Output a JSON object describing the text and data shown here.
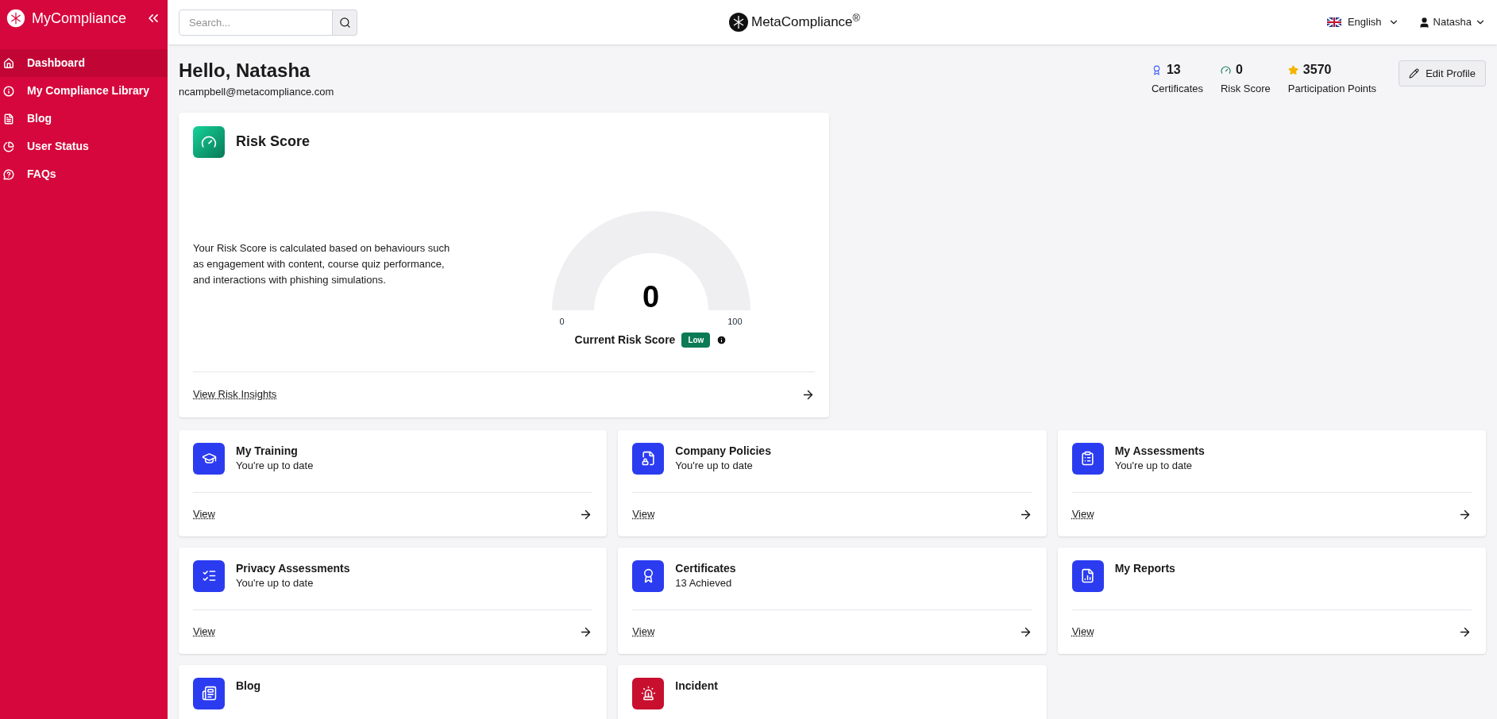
{
  "sidebar": {
    "brand": "MyCompliance",
    "items": [
      {
        "label": "Dashboard",
        "selected": true
      },
      {
        "label": "My Compliance Library",
        "selected": false
      },
      {
        "label": "Blog",
        "selected": false
      },
      {
        "label": "User Status",
        "selected": false
      },
      {
        "label": "FAQs",
        "selected": false
      }
    ]
  },
  "header": {
    "search": {
      "placeholder": "Search..."
    },
    "logo": "MetaCompliance$^{®}$",
    "language": "English",
    "user": "Natasha"
  },
  "greeting": {
    "title": "Hello, Natasha",
    "email": "ncampbell@metacompliance.com"
  },
  "stats": [
    {
      "value": "13",
      "label": "Certificates"
    },
    {
      "value": "0",
      "label": "Risk Score"
    },
    {
      "value": "3570",
      "label": "Participation Points"
    }
  ],
  "edit_profile": "Edit Profile",
  "risk_card": {
    "title": "Risk Score",
    "description": "Your Risk Score is calculated based on behaviours such as engagement with content, course quiz performance, and interactions with phishing simulations.",
    "gauge": {
      "value": "0",
      "min": "0",
      "max": "100"
    },
    "caption": "Current Risk Score",
    "badge": "Low",
    "link": "View Risk Insights"
  },
  "cards": [
    {
      "color": "#2b3cf0",
      "title": "My Training",
      "subtitle": "You're up to date",
      "link": "View"
    },
    {
      "color": "#2b3cf0",
      "title": "Company Policies",
      "subtitle": "You're up to date",
      "link": "View"
    },
    {
      "color": "#2b3cf0",
      "title": "My Assessments",
      "subtitle": "You're up to date",
      "link": "View"
    },
    {
      "color": "#2b3cf0",
      "title": "Privacy Assessments",
      "subtitle": "You're up to date",
      "link": "View"
    },
    {
      "color": "#2b3cf0",
      "title": "Certificates",
      "subtitle": "13 Achieved",
      "link": "View"
    },
    {
      "color": "#2b3cf0",
      "title": "My Reports",
      "link": "View"
    },
    {
      "color": "#2b3cf0",
      "title": "Blog"
    },
    {
      "color": "#c8102e",
      "title": "Incident"
    }
  ]
}
